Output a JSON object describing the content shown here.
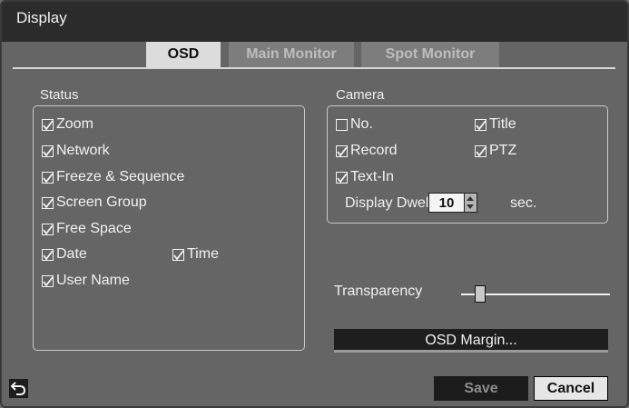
{
  "window": {
    "title": "Display"
  },
  "tabs": [
    {
      "label": "OSD",
      "active": true
    },
    {
      "label": "Main Monitor",
      "active": false
    },
    {
      "label": "Spot Monitor",
      "active": false
    }
  ],
  "status": {
    "label": "Status",
    "items": [
      {
        "label": "Zoom",
        "checked": true
      },
      {
        "label": "Network",
        "checked": true
      },
      {
        "label": "Freeze & Sequence",
        "checked": true
      },
      {
        "label": "Screen Group",
        "checked": true
      },
      {
        "label": "Free Space",
        "checked": true
      },
      {
        "label": "Date",
        "checked": true
      },
      {
        "label": "Time",
        "checked": true
      },
      {
        "label": "User Name",
        "checked": true
      }
    ]
  },
  "camera": {
    "label": "Camera",
    "items": [
      {
        "label": "No.",
        "checked": false
      },
      {
        "label": "Title",
        "checked": true
      },
      {
        "label": "Record",
        "checked": true
      },
      {
        "label": "PTZ",
        "checked": true
      },
      {
        "label": "Text-In",
        "checked": true
      }
    ],
    "dwell_label": "Display Dwell",
    "dwell_value": "10",
    "dwell_unit": "sec."
  },
  "transparency": {
    "label": "Transparency",
    "level": 0.1
  },
  "buttons": {
    "osd_margin": "OSD Margin...",
    "save": "Save",
    "cancel": "Cancel"
  },
  "icons": {
    "back": "back-arrow-icon"
  },
  "colors": {
    "background": "#656565",
    "titlebar": "#2b2b2b",
    "active_tab": "#dcdcdc"
  }
}
